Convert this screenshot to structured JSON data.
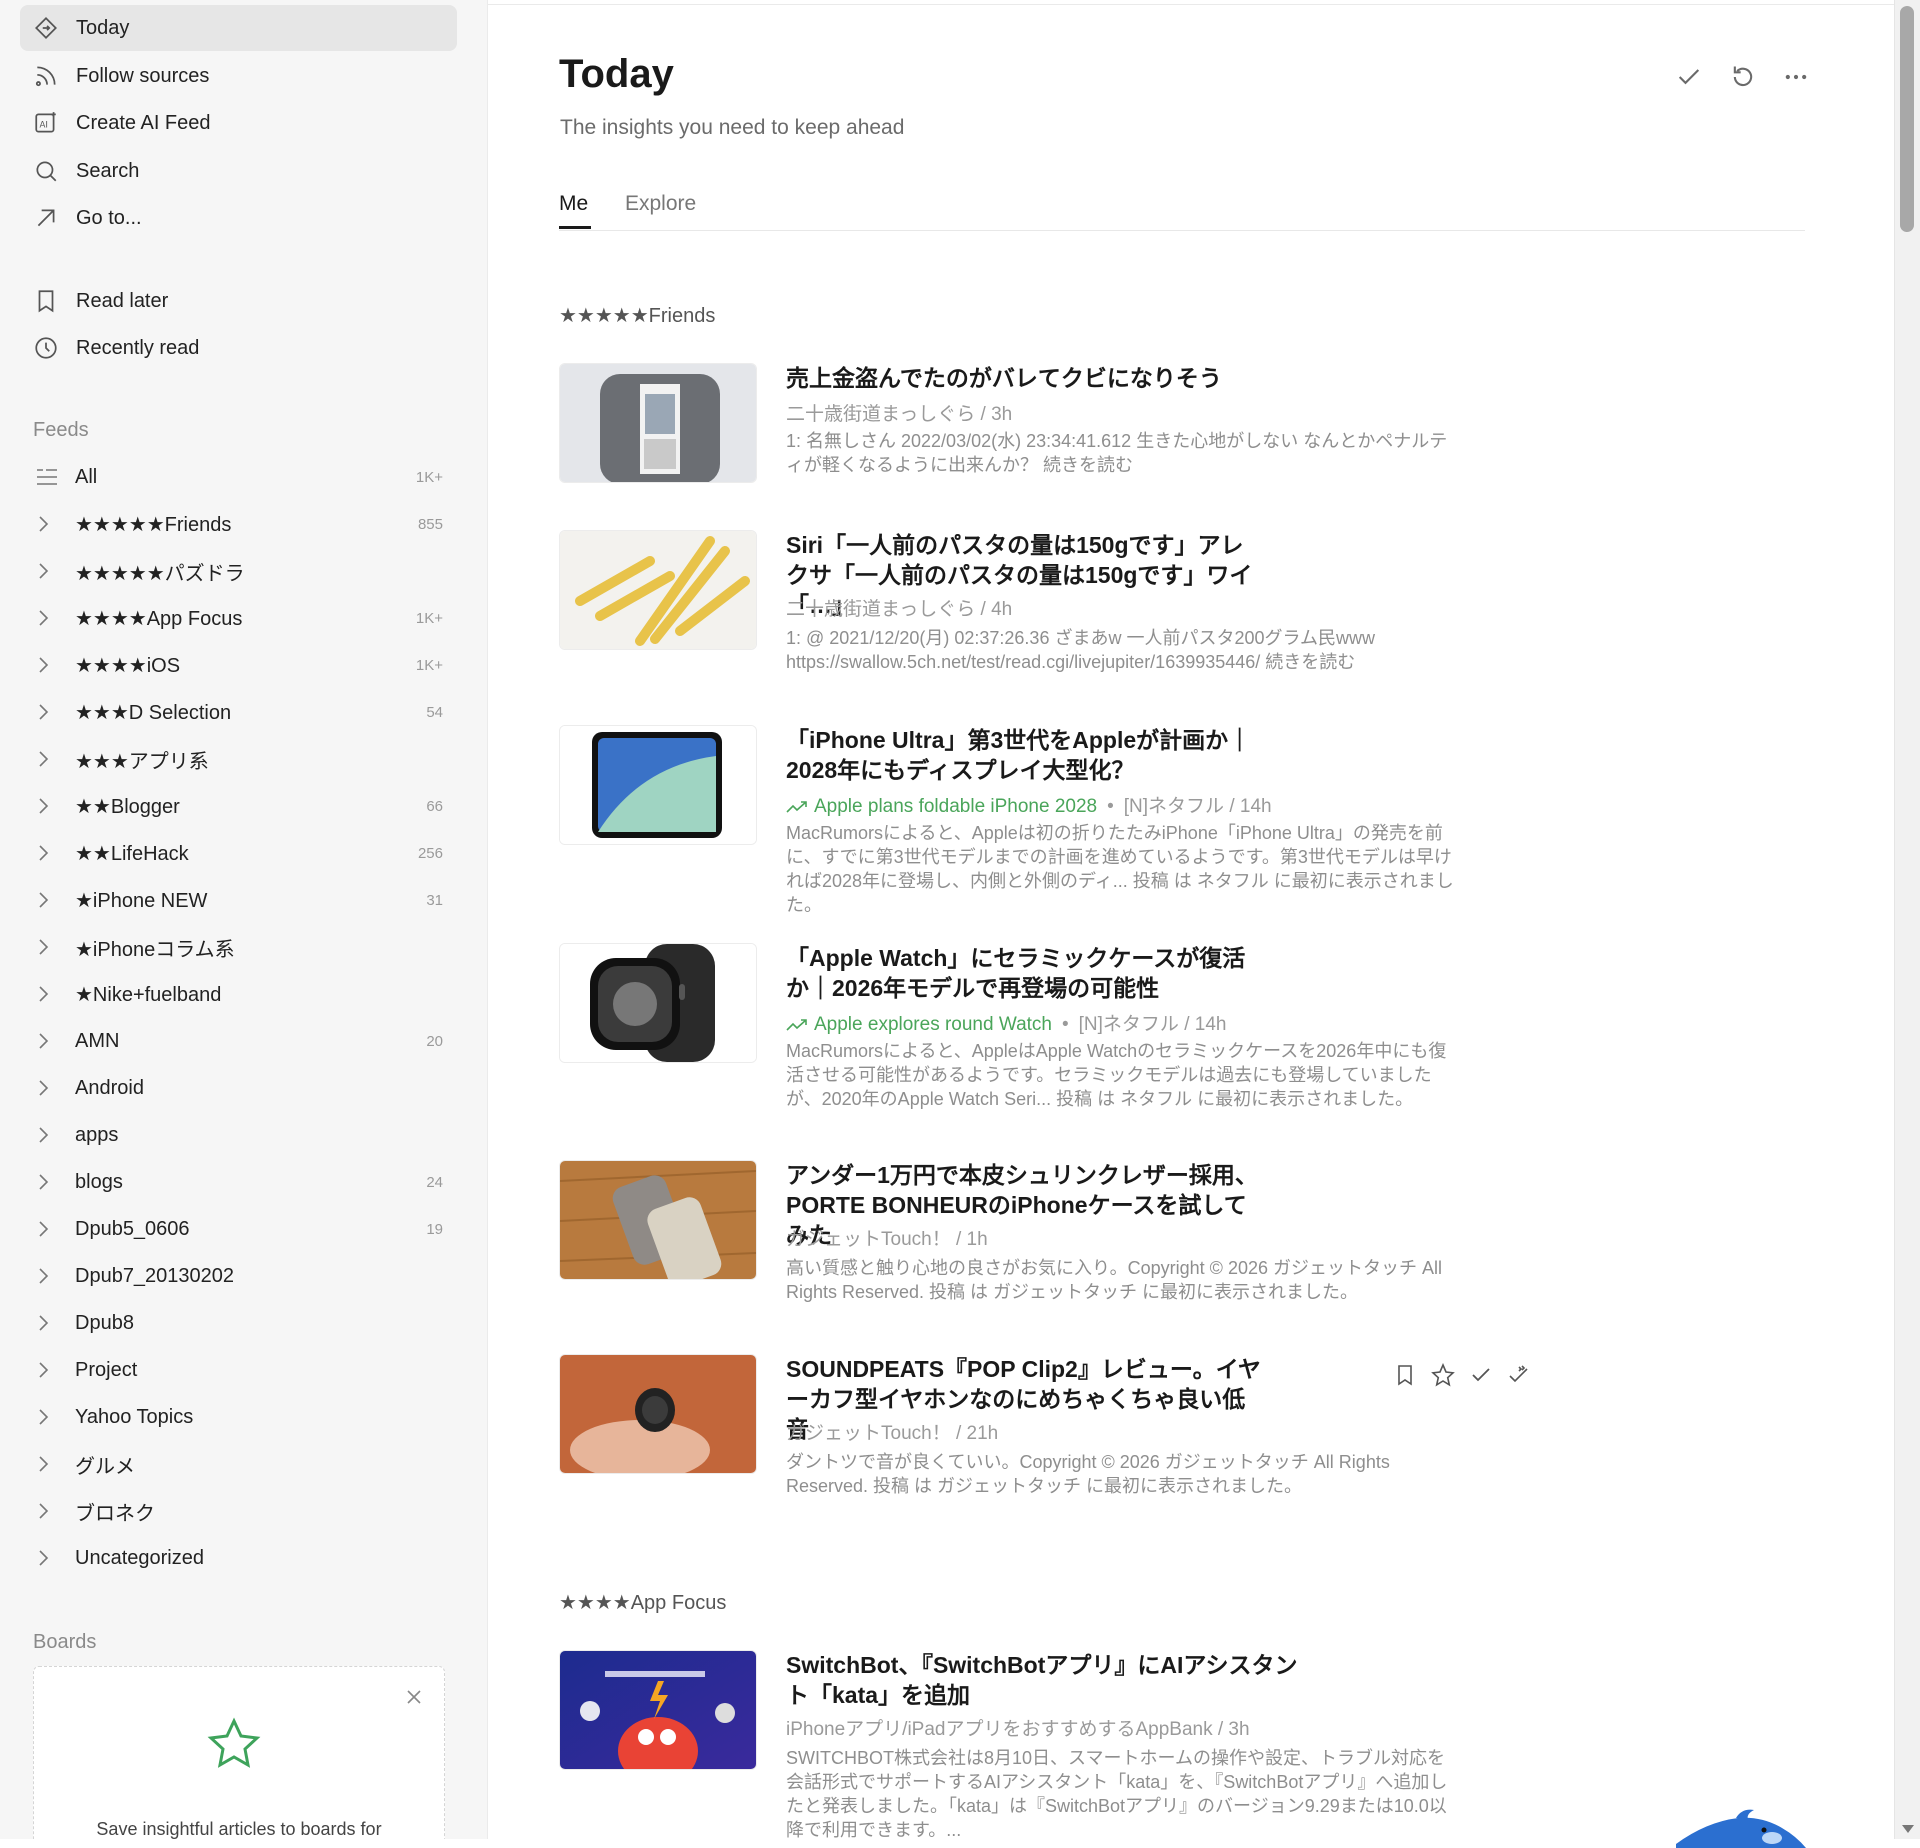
{
  "nav": {
    "today": "Today",
    "follow_sources": "Follow sources",
    "create_ai_feed": "Create AI Feed",
    "search": "Search",
    "go_to": "Go to...",
    "read_later": "Read later",
    "recently_read": "Recently read"
  },
  "feeds": {
    "label": "Feeds",
    "all": {
      "name": "All",
      "count": "1K+"
    },
    "items": [
      {
        "name": "★★★★★Friends",
        "count": "855"
      },
      {
        "name": "★★★★★パズドラ",
        "count": ""
      },
      {
        "name": "★★★★App Focus",
        "count": "1K+"
      },
      {
        "name": "★★★★iOS",
        "count": "1K+"
      },
      {
        "name": "★★★D Selection",
        "count": "54"
      },
      {
        "name": "★★★アプリ系",
        "count": ""
      },
      {
        "name": "★★Blogger",
        "count": "66"
      },
      {
        "name": "★★LifeHack",
        "count": "256"
      },
      {
        "name": "★iPhone NEW",
        "count": "31"
      },
      {
        "name": "★iPhoneコラム系",
        "count": ""
      },
      {
        "name": "★Nike+fuelband",
        "count": ""
      },
      {
        "name": "AMN",
        "count": "20"
      },
      {
        "name": "Android",
        "count": ""
      },
      {
        "name": "apps",
        "count": ""
      },
      {
        "name": "blogs",
        "count": "24"
      },
      {
        "name": "Dpub5_0606",
        "count": "19"
      },
      {
        "name": "Dpub7_20130202",
        "count": ""
      },
      {
        "name": "Dpub8",
        "count": ""
      },
      {
        "name": "Project",
        "count": ""
      },
      {
        "name": "Yahoo Topics",
        "count": ""
      },
      {
        "name": "グルメ",
        "count": ""
      },
      {
        "name": "ブロネク",
        "count": ""
      },
      {
        "name": "Uncategorized",
        "count": ""
      }
    ]
  },
  "boards": {
    "label": "Boards",
    "message": "Save insightful articles to boards for"
  },
  "main": {
    "title": "Today",
    "subtitle": "The insights you need to keep ahead",
    "tabs": [
      "Me",
      "Explore"
    ]
  },
  "groups": [
    {
      "label": "★★★★★Friends",
      "articles": [
        {
          "title": "売上金盗んでたのがバレてクビになりそう",
          "meta": "二十歳街道まっしぐら / 3h",
          "summary": "1: 名無しさん 2022/03/02(水) 23:34:41.612 生きた心地がしない なんとかペナルティが軽くなるように出来んか？ 続きを読む"
        },
        {
          "title": "Siri「一人前のパスタの量は150gです」アレクサ「一人前のパスタの量は150gです」ワイ「…」",
          "meta": "二十歳街道まっしぐら / 4h",
          "summary": "1: @ 2021/12/20(月) 02:37:26.36 ざまあw 一人前パスタ200グラム民www https://swallow.5ch.net/test/read.cgi/livejupiter/1639935446/ 続きを読む"
        },
        {
          "title": "「iPhone Ultra」第3世代をAppleが計画か｜2028年にもディスプレイ大型化？",
          "trend": "Apple plans foldable iPhone 2028",
          "meta": "[N]ネタフル / 14h",
          "summary": "MacRumorsによると、Appleは初の折りたたみiPhone「iPhone Ultra」の発売を前に、すでに第3世代モデルまでの計画を進めているようです。第3世代モデルは早ければ2028年に登場し、内側と外側のディ... 投稿 は ネタフル に最初に表示されました。"
        },
        {
          "title": "「Apple Watch」にセラミックケースが復活か｜2026年モデルで再登場の可能性",
          "trend": "Apple explores round Watch",
          "meta": "[N]ネタフル / 14h",
          "summary": "MacRumorsによると、AppleはApple Watchのセラミックケースを2026年中にも復活させる可能性があるようです。セラミックモデルは過去にも登場していましたが、2020年のApple Watch Seri... 投稿 は ネタフル に最初に表示されました。"
        },
        {
          "title": "アンダー1万円で本皮シュリンクレザー採用、PORTE BONHEURのiPhoneケースを試してみた",
          "meta": "ガジェットTouch！ / 1h",
          "summary": "高い質感と触り心地の良さがお気に入り。Copyright © 2026 ガジェットタッチ All Rights Reserved. 投稿 は ガジェットタッチ に最初に表示されました。"
        },
        {
          "title": "SOUNDPEATS『POP Clip2』レビュー。イヤーカフ型イヤホンなのにめちゃくちゃ良い低音",
          "meta": "ガジェットTouch！ / 21h",
          "summary": "ダントツで音が良くていい。Copyright © 2026 ガジェットタッチ All Rights Reserved. 投稿 は ガジェットタッチ に最初に表示されました。"
        }
      ]
    },
    {
      "label": "★★★★App Focus",
      "articles": [
        {
          "title": "SwitchBot、『SwitchBotアプリ』にAIアシスタント「kata」を追加",
          "meta": "iPhoneアプリ/iPadアプリをおすすめするAppBank / 3h",
          "summary": "SWITCHBOT株式会社は8月10日、スマートホームの操作や設定、トラブル対応を会話形式でサポートするAIアシスタント「kata」を、『SwitchBotアプリ』へ追加したと発表しました。「kata」は『SwitchBotアプリ』のバージョン9.29または10.0以降で利用できます。..."
        }
      ]
    }
  ],
  "icons": {
    "today": "today-diamond-icon",
    "follow": "rss-icon",
    "ai": "ai-feed-icon",
    "search": "search-icon",
    "goto": "arrow-up-right-icon",
    "read_later": "bookmark-icon",
    "recent": "clock-icon"
  },
  "colors": {
    "accent_green": "#4aa55a",
    "sidebar_bg": "#f6f6f6",
    "active_bg": "#e6e6e6"
  }
}
